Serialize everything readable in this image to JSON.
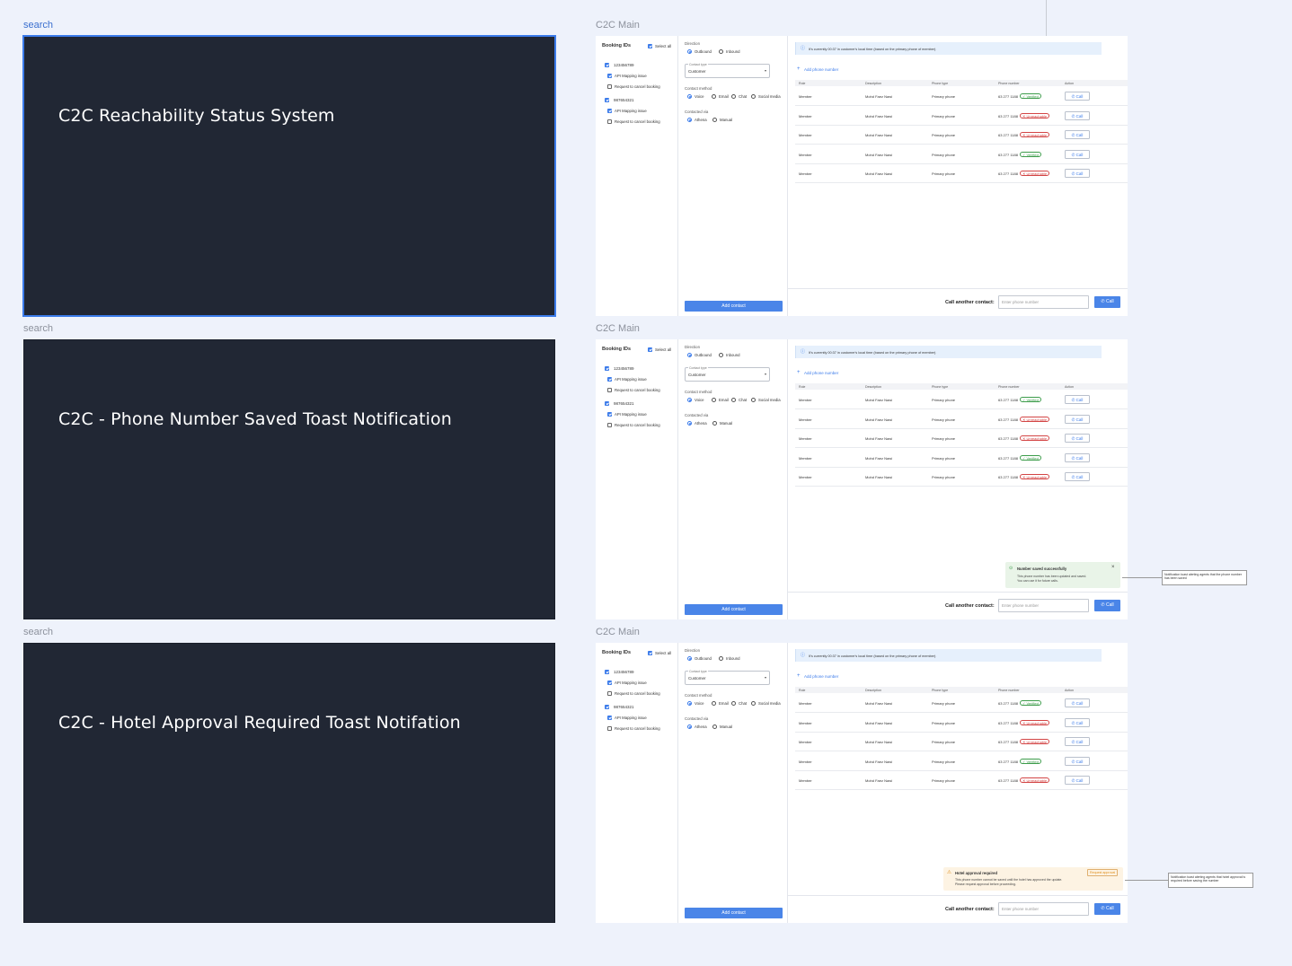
{
  "frames": [
    {
      "label": "search",
      "title": "C2C Reachability Status System",
      "active": true
    },
    {
      "label": "search",
      "title": "C2C - Phone Number Saved Toast Notification",
      "active": false
    },
    {
      "label": "search",
      "title": "C2C - Hotel Approval Required Toast Notifation",
      "active": false
    }
  ],
  "screens": [
    {
      "label": "C2C Main",
      "ids": [
        "123456789",
        "987654321"
      ]
    },
    {
      "label": "C2C Main",
      "ids": [
        "123456789",
        "987654321"
      ]
    },
    {
      "label": "C2C Main",
      "ids": [
        "123456789",
        "987654321"
      ]
    }
  ],
  "left": {
    "title": "Booking IDs",
    "select_all": "Select all",
    "issue1": "API Mapping issue",
    "issue2": "Request to cancel booking"
  },
  "middle": {
    "direction_label": "Direction",
    "outbound": "Outbound",
    "inbound": "Inbound",
    "contact_type_label": "Contact type",
    "contact_type_value": "Customer",
    "contact_method_label": "Contact method",
    "voice": "Voice",
    "email": "Email",
    "chat": "Chat",
    "social": "Social media",
    "contacted_via_label": "Contacted via",
    "athena": "Athena",
    "manual": "Manual",
    "add_contact": "Add contact"
  },
  "right": {
    "banner": "It's currently 00:37 in customer's local time (based on the primary phone of member)",
    "add_phone": "Add phone number",
    "columns": [
      "Role",
      "Description",
      "Phone type",
      "Phone number",
      "Action"
    ],
    "rows": [
      {
        "role": "Member",
        "desc": "Mohd Faez Nawi",
        "type": "Primary phone",
        "number": "63 277 1188",
        "status": "Verified",
        "ok": true
      },
      {
        "role": "Member",
        "desc": "Mohd Faez Nawi",
        "type": "Primary phone",
        "number": "63 277 1188",
        "status": "Unreachable",
        "ok": false
      },
      {
        "role": "Member",
        "desc": "Mohd Faez Nawi",
        "type": "Primary phone",
        "number": "63 277 1188",
        "status": "Unreachable",
        "ok": false
      },
      {
        "role": "Member",
        "desc": "Mohd Faez Nawi",
        "type": "Primary phone",
        "number": "63 277 1188",
        "status": "Verified",
        "ok": true
      },
      {
        "role": "Member",
        "desc": "Mohd Faez Nawi",
        "type": "Primary phone",
        "number": "63 277 1188",
        "status": "Unreachable",
        "ok": false
      }
    ],
    "call_label": "Call",
    "call_another": "Call another contact:",
    "phone_placeholder": "Enter phone number"
  },
  "toast_saved": {
    "title": "Number saved successfully",
    "line1": "This phone number has been updated and saved.",
    "line2": "You can use it for future calls."
  },
  "toast_saved_note": "Notification toast alerting agents that the phone number has been saved",
  "toast_hotel": {
    "title": "Hotel approval required",
    "line1": "This phone number cannot be saved until the hotel has approved the update.",
    "line2": "Please request approval before proceeding.",
    "action": "Request approval"
  },
  "toast_hotel_note": "Notification toast alerting agents that hotel approval is required before saving the number",
  "colors": {
    "accent": "#4a85e8",
    "cover": "#212734",
    "bg": "#eef2fb"
  }
}
